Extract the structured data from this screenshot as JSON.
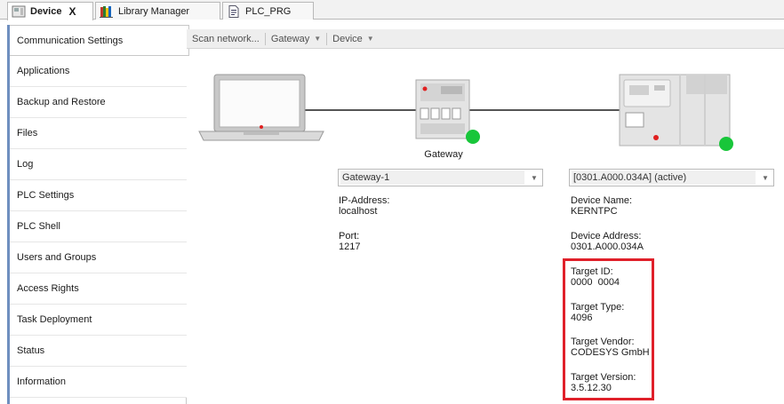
{
  "tabs": [
    {
      "label": "Device",
      "icon": "device-icon",
      "active": true,
      "close_label": "X"
    },
    {
      "label": "Library Manager",
      "icon": "library-icon",
      "active": false
    },
    {
      "label": "PLC_PRG",
      "icon": "document-icon",
      "active": false
    }
  ],
  "sidebar": {
    "items": [
      {
        "label": "Communication Settings",
        "active": true
      },
      {
        "label": "Applications"
      },
      {
        "label": "Backup and Restore"
      },
      {
        "label": "Files"
      },
      {
        "label": "Log"
      },
      {
        "label": "PLC Settings"
      },
      {
        "label": "PLC Shell"
      },
      {
        "label": "Users and Groups"
      },
      {
        "label": "Access Rights"
      },
      {
        "label": "Task Deployment"
      },
      {
        "label": "Status"
      },
      {
        "label": "Information"
      }
    ]
  },
  "toolbar": {
    "scan": "Scan network...",
    "gateway": "Gateway",
    "device": "Device"
  },
  "gateway": {
    "label": "Gateway",
    "selected": "Gateway-1",
    "ip_label": "IP-Address:",
    "ip_value": "localhost",
    "port_label": "Port:",
    "port_value": "1217",
    "status_color": "#18c63a"
  },
  "device": {
    "selected": "[0301.A000.034A] (active)",
    "name_label": "Device Name:",
    "name_value": "KERNTPC",
    "address_label": "Device Address:",
    "address_value": "0301.A000.034A",
    "target_id_label": "Target ID:",
    "target_id_value": "0000  0004",
    "target_type_label": "Target Type:",
    "target_type_value": "4096",
    "target_vendor_label": "Target Vendor:",
    "target_vendor_value": "CODESYS GmbH",
    "target_version_label": "Target Version:",
    "target_version_value": "3.5.12.30",
    "status_color": "#18c63a",
    "highlight_color": "#e0202a"
  }
}
